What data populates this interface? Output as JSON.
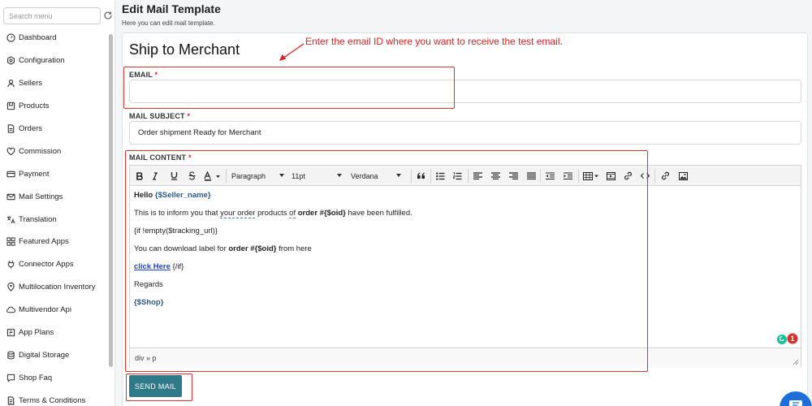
{
  "sidebar": {
    "search_placeholder": "Search menu",
    "items": [
      {
        "label": "Dashboard",
        "icon": "dashboard-icon"
      },
      {
        "label": "Configuration",
        "icon": "settings-icon"
      },
      {
        "label": "Sellers",
        "icon": "user-icon"
      },
      {
        "label": "Products",
        "icon": "products-icon"
      },
      {
        "label": "Orders",
        "icon": "orders-icon"
      },
      {
        "label": "Commission",
        "icon": "commission-icon"
      },
      {
        "label": "Payment",
        "icon": "payment-icon"
      },
      {
        "label": "Mail Settings",
        "icon": "mail-icon"
      },
      {
        "label": "Translation",
        "icon": "translation-icon"
      },
      {
        "label": "Featured Apps",
        "icon": "apps-icon"
      },
      {
        "label": "Connector Apps",
        "icon": "plug-icon"
      },
      {
        "label": "Multilocation Inventory",
        "icon": "location-icon"
      },
      {
        "label": "Multivendor Api",
        "icon": "cloud-icon"
      },
      {
        "label": "App Plans",
        "icon": "plans-icon"
      },
      {
        "label": "Digital Storage",
        "icon": "database-icon"
      },
      {
        "label": "Shop Faq",
        "icon": "faq-icon"
      },
      {
        "label": "Terms & Conditions",
        "icon": "terms-icon"
      }
    ]
  },
  "header": {
    "title": "Edit Mail Template",
    "subtitle": "Here you can edit mail template."
  },
  "template": {
    "title": "Ship to Merchant",
    "annotation": "Enter the email ID where you want to receive the test email.",
    "email_label": "EMAIL",
    "email_value": "",
    "subject_label": "MAIL SUBJECT",
    "subject_value": "Order shipment Ready for Merchant",
    "content_label": "MAIL CONTENT",
    "required_mark": "*"
  },
  "editor": {
    "format_select": "Paragraph",
    "size_select": "11pt",
    "font_select": "Verdana",
    "path": "div » p",
    "grammarly_count": "1",
    "lines": {
      "l1_text": "Hello ",
      "l1_var": "{$Seller_name}",
      "l2_a": "This is to inform you that ",
      "l2_b": "your order",
      "l2_c": " products ",
      "l2_d": "of",
      "l2_e": " ",
      "l2_f": "order #{$oid}",
      "l2_g": " have been fulfilled.",
      "l3": "{if !empty($tracking_url)}",
      "l4_a": "You can download label for ",
      "l4_b": "order #{$oid}",
      "l4_c": " from here",
      "l5_link": "click Here",
      "l5_rest": " {/if}",
      "l6": "Regards",
      "l7": "{$Shop}"
    }
  },
  "actions": {
    "send_label": "SEND MAIL"
  },
  "colors": {
    "accent": "#2f7a89",
    "annotation": "#dd2222",
    "variable": "#2c5a8a",
    "chat": "#1e6fd9"
  }
}
